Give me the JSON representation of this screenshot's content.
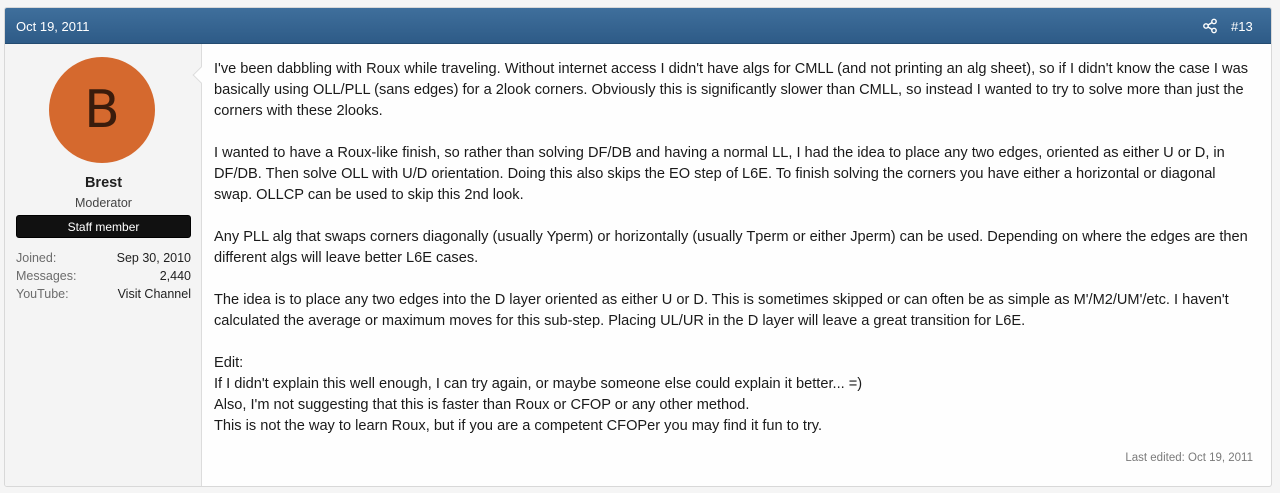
{
  "header": {
    "date": "Oct 19, 2011",
    "share_icon": "share-icon",
    "post_number": "#13"
  },
  "user": {
    "avatar_letter": "B",
    "avatar_color": "#d5692e",
    "name": "Brest",
    "title": "Moderator",
    "badge": "Staff member",
    "stats": [
      {
        "label": "Joined:",
        "value": "Sep 30, 2010"
      },
      {
        "label": "Messages:",
        "value": "2,440"
      },
      {
        "label": "YouTube:",
        "value": "Visit Channel"
      }
    ]
  },
  "message": {
    "paragraphs": [
      "I've been dabbling with Roux while traveling. Without internet access I didn't have algs for CMLL (and not printing an alg sheet), so if I didn't know the case I was basically using OLL/PLL (sans edges) for a 2look corners. Obviously this is significantly slower than CMLL, so instead I wanted to try to solve more than just the corners with these 2looks.",
      "I wanted to have a Roux-like finish, so rather than solving DF/DB and having a normal LL, I had the idea to place any two edges, oriented as either U or D, in DF/DB. Then solve OLL with U/D orientation. Doing this also skips the EO step of L6E. To finish solving the corners you have either a horizontal or diagonal swap. OLLCP can be used to skip this 2nd look.",
      "Any PLL alg that swaps corners diagonally (usually Yperm) or horizontally (usually Tperm or either Jperm) can be used. Depending on where the edges are then different algs will leave better L6E cases.",
      "The idea is to place any two edges into the D layer oriented as either U or D. This is sometimes skipped or can often be as simple as M'/M2/UM'/etc. I haven't calculated the average or maximum moves for this sub-step. Placing UL/UR in the D layer will leave a great transition for L6E."
    ],
    "edit_lines": [
      "Edit:",
      "If I didn't explain this well enough, I can try again, or maybe someone else could explain it better... =)",
      "Also, I'm not suggesting that this is faster than Roux or CFOP or any other method.",
      "This is not the way to learn Roux, but if you are a competent CFOPer you may find it fun to try."
    ]
  },
  "last_edited": "Last edited: Oct 19, 2011"
}
